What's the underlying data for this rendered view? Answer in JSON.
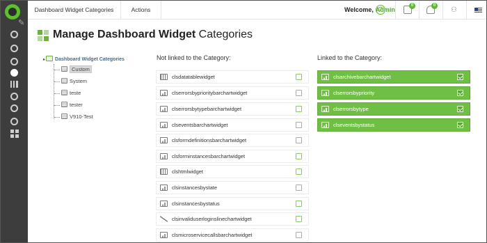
{
  "topbar": {
    "tabs": [
      {
        "label": "Dashboard Widget Categories"
      },
      {
        "label": "Actions"
      }
    ],
    "welcome": "Welcome,",
    "user": "Admin",
    "help_glyph": "?",
    "notifications": [
      {
        "icon": "task-list-icon",
        "count": "0"
      },
      {
        "icon": "bell-icon",
        "count": "0"
      }
    ],
    "user_settings_icon": "user-settings-icon",
    "flag_icon": "us-flag-icon"
  },
  "sidebar": {
    "icons": [
      "logo-icon",
      "pin-icon",
      "dashboard-icon",
      "compass-icon",
      "add-icon",
      "settings-gear-icon",
      "bar-chart-icon",
      "cogs-icon",
      "gear-icon",
      "help-circle-icon",
      "grid-apps-icon"
    ]
  },
  "page": {
    "title_bold": "Manage Dashboard Widget",
    "title_rest": " Categories"
  },
  "tree": {
    "root": "Dashboard Widget Categories",
    "items": [
      {
        "label": "Custom",
        "selected": true
      },
      {
        "label": "System",
        "selected": false
      },
      {
        "label": "teste",
        "selected": false
      },
      {
        "label": "tester",
        "selected": false
      },
      {
        "label": "V910-Test",
        "selected": false
      }
    ]
  },
  "not_linked": {
    "title": "Not linked to the Category:",
    "items": [
      {
        "label": "clsdatatablewidget",
        "icon": "table-icon"
      },
      {
        "label": "clserrorsbyprioritybarchartwidget",
        "icon": "bar-chart-icon"
      },
      {
        "label": "clserrorsbytypebarchartwidget",
        "icon": "bar-chart-icon"
      },
      {
        "label": "clseventsbarchartwidget",
        "icon": "bar-chart-icon"
      },
      {
        "label": "clsformdefinitionsbarchartwidget",
        "icon": "bar-chart-icon"
      },
      {
        "label": "clsforminstancesbarchartwidget",
        "icon": "bar-chart-icon"
      },
      {
        "label": "clshtmlwidget",
        "icon": "html-icon"
      },
      {
        "label": "clsinstancesbystate",
        "icon": "search-chart-icon"
      },
      {
        "label": "clsinstancesbystatus",
        "icon": "search-chart-icon"
      },
      {
        "label": "clsinvaliduserloginslinechartwidget",
        "icon": "line-chart-icon"
      },
      {
        "label": "clsmicroservicecallsbarchartwidget",
        "icon": "bar-chart-icon"
      }
    ]
  },
  "linked": {
    "title": "Linked to the Category:",
    "items": [
      {
        "label": "clsarchivebarchartwidget",
        "checked": true
      },
      {
        "label": "clserrorsbypriority",
        "checked": true
      },
      {
        "label": "clserrorsbytype",
        "checked": true
      },
      {
        "label": "clseventsbystatus",
        "checked": true
      }
    ]
  },
  "colors": {
    "accent_green": "#6fbf44",
    "sidebar_bg": "#3d3d3d",
    "admin_green": "#4fa62d"
  }
}
